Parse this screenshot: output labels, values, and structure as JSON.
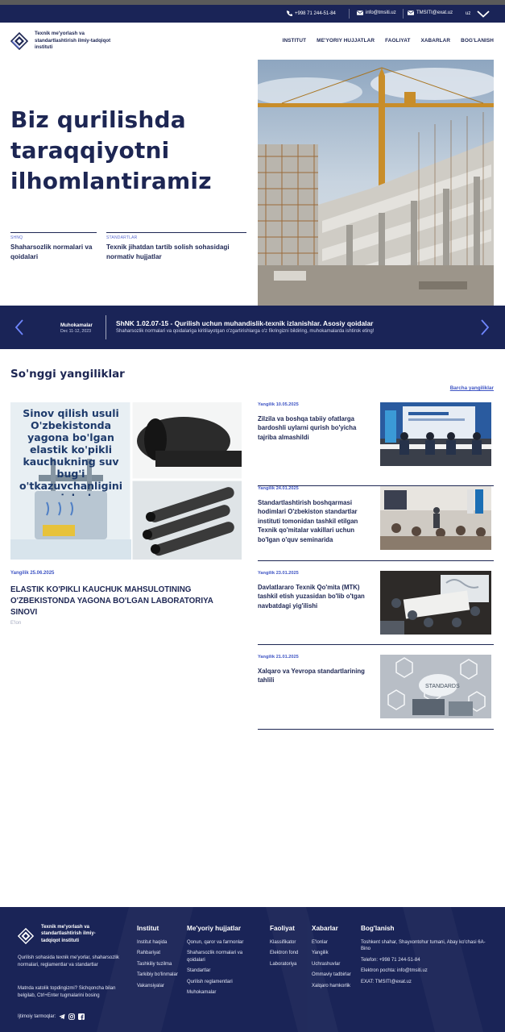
{
  "topbar": {
    "phone": "+998 71 244-51-84",
    "email1": "info@tmsiti.uz",
    "email2": "TMSITI@exat.uz",
    "lang": "uz"
  },
  "header": {
    "logo_text": "Texnik me'yorlash va standartlashtirish ilmiy-tadqiqot instituti",
    "nav": [
      "INSTITUT",
      "ME'YORIY HUJJATLAR",
      "FAOLIYAT",
      "XABARLAR",
      "BOG'LANISH"
    ]
  },
  "hero": {
    "title": "Biz qurilishda taraqqiyotni ilhomlantiramiz",
    "cards": [
      {
        "tag": "SHNQ",
        "title": "Shaharsozlik normalari va qoidalari"
      },
      {
        "tag": "STANDARTLAR",
        "title": "Texnik jihatdan tartib solish sohasidagi normativ hujjatlar"
      }
    ]
  },
  "banner": {
    "category": "Muhokamalar",
    "date": "Dec 11-12, 2023",
    "title": "ShNK 1.02.07-15 - Qurilish uchun muhandislik-texnik izlanishlar. Asosiy qoidalar",
    "description": "Shaharsozlik normalari va qoidalariga kiritilayotgan o'zgartirishlarga o'z fikringizni bildiring, muhokamalarda ishtirok eting!"
  },
  "news": {
    "section_title": "So'nggi yangiliklar",
    "all_link": "Barcha yangiliklar",
    "main": {
      "image_text": "Sinov qilish usuli O'zbekistonda yagona bo'lgan elastik ko'pikli kauchukning suv bug'i o'tkazuvchanligini aniqlash",
      "date": "Yangilik 25.06.2025",
      "title": "ELASTIK KO'PIKLI KAUCHUK MAHSULOTINING O'ZBEKISTONDA YAGONA BO'LGAN LABORATORIYA SINOVI",
      "tag": "E'lon"
    },
    "items": [
      {
        "date": "Yangilik 10.05.2025",
        "title": "Zilzila va boshqa tabiiy ofatlarga bardoshli uylarni qurish bo'yicha tajriba almashildi"
      },
      {
        "date": "Yangilik 24.01.2025",
        "title": "Standartlashtirish boshqarmasi hodimlari O'zbekiston standartlar instituti tomonidan tashkil etilgan Texnik qo'mitalar vakillari uchun bo'lgan o'quv seminarida"
      },
      {
        "date": "Yangilik 23.01.2025",
        "title": "Davlatlararo Texnik Qo'mita (MTK) tashkil etish yuzasidan bo'lib o'tgan navbatdagi yig'ilishi"
      },
      {
        "date": "Yangilik 21.01.2025",
        "title": "Xalqaro va Yevropa standartlarining tahlili"
      }
    ]
  },
  "footer": {
    "logo_text": "Texnik me'yorlash va standartlashtirish ilmiy-tadqiqot instituti",
    "description": "Qurilish sohasida texnik me'yorlar, shaharsozlik normalari, reglamentlar va standartlar",
    "hint": "Matnda xatolik topdingizmi? Sichqoncha bilan belgilab, Ctrl+Enter tugmalarini bosing",
    "social_label": "Ijtimoiy tarmoqlar:",
    "columns": [
      {
        "title": "Institut",
        "links": [
          "Institut haqida",
          "Rahbariyat",
          "Tashkiliy tuzilma",
          "Tarkibiy bo'linmalar",
          "Vakansiyalar"
        ]
      },
      {
        "title": "Me'yoriy hujjatlar",
        "links": [
          "Qonun, qaror va farmonlar",
          "Shaharsozlik normalari va qoidalari",
          "Standartlar",
          "Qurilish reglamentlari",
          "Muhokamalar"
        ]
      },
      {
        "title": "Faoliyat",
        "links": [
          "Klassifikator",
          "Elektron fond",
          "Laboratoriya"
        ]
      },
      {
        "title": "Xabarlar",
        "links": [
          "E'lonlar",
          "Yangilik",
          "Uchrashuvlar",
          "Ommaviy tadbirlar",
          "Xalqaro hamkorlik"
        ]
      },
      {
        "title": "Bog'lanish",
        "links": [
          "Toshkent shahar, Shayxontohur tumani, Abay ko'chasi 6A-Bino",
          "Telefon: +998 71 244-51-84",
          "Elektron pochta: info@tmsiti.uz",
          "EXAT: TMSITI@exat.uz"
        ]
      }
    ]
  }
}
